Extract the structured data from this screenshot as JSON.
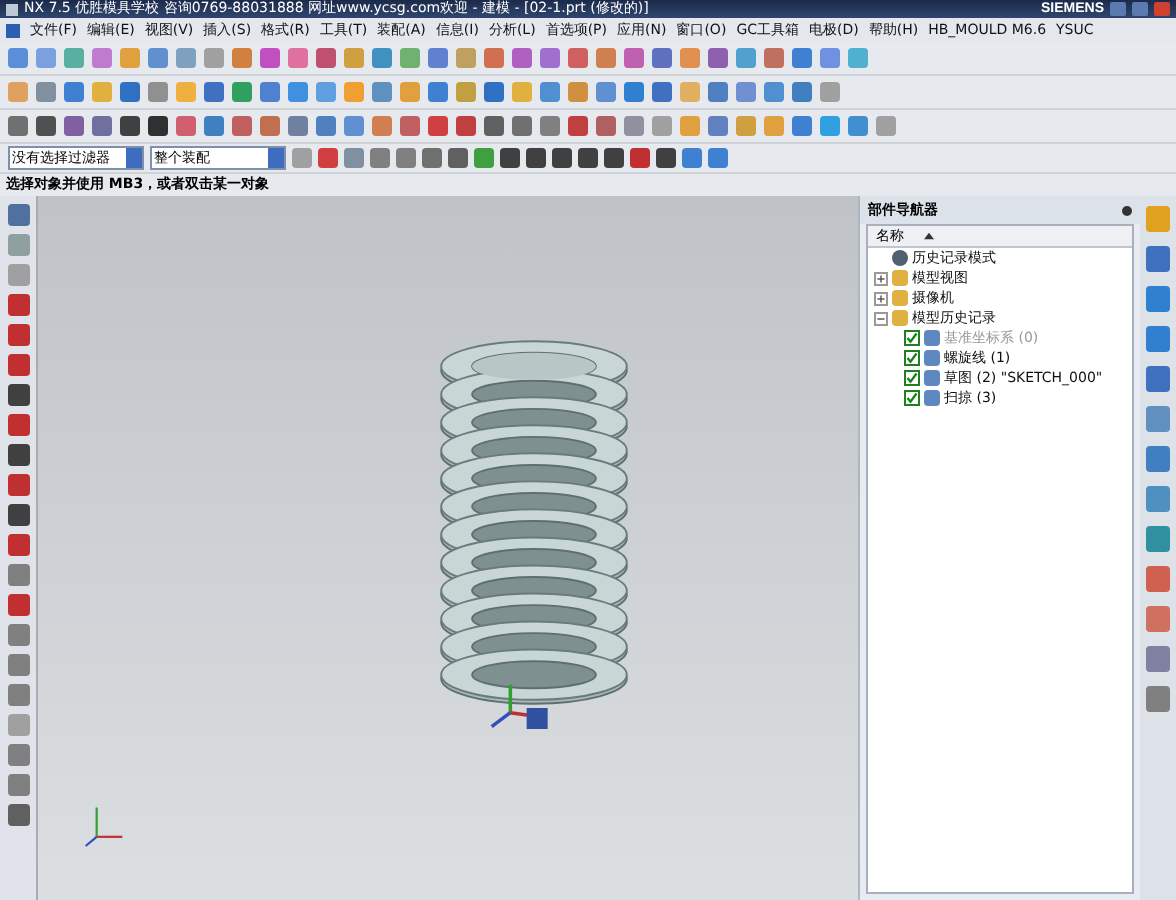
{
  "window": {
    "title": "NX 7.5 优胜模具学校 咨询0769-88031888 网址www.ycsg.com欢迎 - 建模 - [02-1.prt (修改的)]",
    "brand": "SIEMENS"
  },
  "menu": [
    "文件(F)",
    "编辑(E)",
    "视图(V)",
    "插入(S)",
    "格式(R)",
    "工具(T)",
    "装配(A)",
    "信息(I)",
    "分析(L)",
    "首选项(P)",
    "应用(N)",
    "窗口(O)",
    "GC工具箱",
    "电极(D)",
    "帮助(H)",
    "HB_MOULD M6.6",
    "YSUC"
  ],
  "filters": [
    {
      "value": "没有选择过滤器"
    },
    {
      "value": "整个装配"
    }
  ],
  "status": "选择对象并使用 MB3，或者双击某一对象",
  "navigator": {
    "title": "部件导航器",
    "column": "名称",
    "items": [
      {
        "kind": "leaf",
        "label": "历史记录模式"
      },
      {
        "kind": "folder",
        "label": "模型视图",
        "expanded": false
      },
      {
        "kind": "folder",
        "label": "摄像机",
        "expanded": false
      },
      {
        "kind": "folder",
        "label": "模型历史记录",
        "expanded": true,
        "children": [
          {
            "label": "基准坐标系 (0)",
            "checked": true,
            "disabled": true
          },
          {
            "label": "螺旋线 (1)",
            "checked": true,
            "disabled": false
          },
          {
            "label": "草图 (2) \"SKETCH_000\"",
            "checked": true,
            "disabled": false
          },
          {
            "label": "扫掠 (3)",
            "checked": true,
            "disabled": false
          }
        ]
      }
    ]
  }
}
